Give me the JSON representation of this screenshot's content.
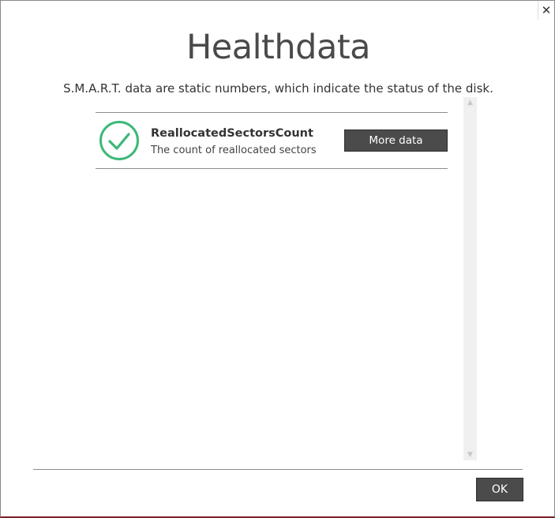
{
  "window": {
    "close_glyph": "✕"
  },
  "header": {
    "title": "Healthdata",
    "subtitle": "S.M.A.R.T. data are static numbers, which indicate the status of the disk."
  },
  "attributes": [
    {
      "name": "ReallocatedSectorsCount",
      "description": "The count of reallocated sectors",
      "status_icon": "check-circle-icon",
      "status_color": "#3cb878",
      "button_label": "More data"
    }
  ],
  "footer": {
    "ok_label": "OK"
  },
  "colors": {
    "button_bg": "#4b4b4b",
    "window_bottom_border": "#7a1f2b"
  }
}
